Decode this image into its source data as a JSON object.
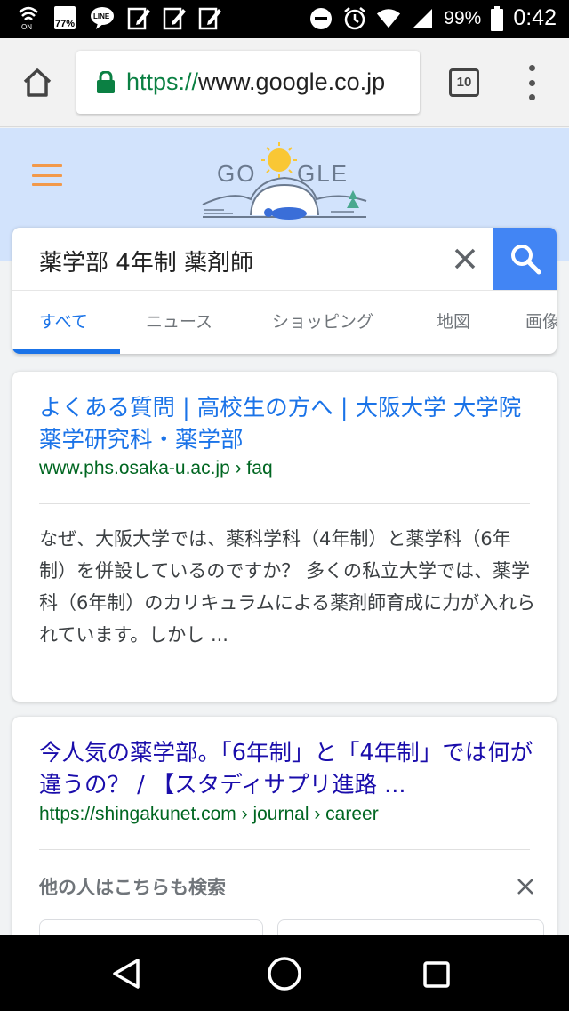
{
  "status_bar": {
    "battery_badge": "77%",
    "line_label": "LINE",
    "battery_percent": "99%",
    "time": "0:42"
  },
  "browser": {
    "url": "https://www.google.co.jp",
    "url_prefix": "https://",
    "url_host": "www.google.co.jp",
    "tab_count": "10"
  },
  "google": {
    "doodle_text": "GOOGLE"
  },
  "search": {
    "query": "薬学部 4年制 薬剤師",
    "tabs": [
      {
        "label": "すべて",
        "active": true
      },
      {
        "label": "ニュース"
      },
      {
        "label": "ショッピング"
      },
      {
        "label": "地図"
      },
      {
        "label": "画像"
      }
    ]
  },
  "results": [
    {
      "title": "よくある質問 | 高校生の方へ | 大阪大学 大学院薬学研究科・薬学部",
      "url": "www.phs.osaka-u.ac.jp › faq",
      "snippet": "なぜ、大阪大学では、薬科学科（4年制）と薬学科（6年制）を併設しているのですか？ 多くの私立大学では、薬学科（6年制）のカリキュラムによる薬剤師育成に力が入れられています。しかし ..."
    },
    {
      "title": "今人気の薬学部。「6年制」と「4年制」では何が違うの？ / 【スタディサプリ進路 ...",
      "url": "https://shingakunet.com › journal › career"
    }
  ],
  "people_also_search": {
    "title": "他の人はこちらも検索"
  },
  "colors": {
    "link_blue": "#1a73e8",
    "visited_title": "#1a0dab",
    "url_green": "#006621",
    "search_button": "#4285f4",
    "header_bg": "#d2e3fc"
  }
}
